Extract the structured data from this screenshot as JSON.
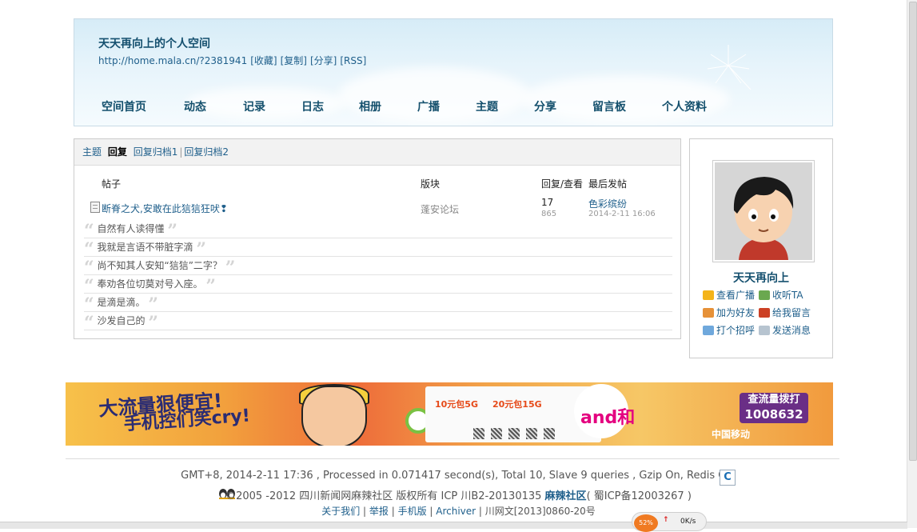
{
  "header": {
    "site_title": "天天再向上的个人空间",
    "url": "http://home.mala.cn/?2381941",
    "links": [
      "[收藏]",
      "[复制]",
      "[分享]",
      "[RSS]"
    ]
  },
  "nav": [
    "空间首页",
    "动态",
    "记录",
    "日志",
    "相册",
    "广播",
    "主题",
    "分享",
    "留言板",
    "个人资料"
  ],
  "tabs": {
    "items": [
      "主题",
      "回复",
      "回复归档1",
      "回复归档2"
    ],
    "active": "回复"
  },
  "table": {
    "headers": [
      "帖子",
      "版块",
      "回复/查看",
      "最后发帖"
    ],
    "row": {
      "subject": "断脊之犬,安敢在此狺狺狂吠❢",
      "forum": "蓬安论坛",
      "replies": "17",
      "views": "865",
      "last_user": "色彩缤纷",
      "last_time": "2014-2-11 16:06"
    },
    "quotes": [
      "自然有人读得懂",
      "我就是言语不带脏字滴",
      "尚不知其人安知“狺狺”二字？",
      "奉劝各位切莫对号入座。",
      "是滴是滴。",
      "沙发自己的"
    ]
  },
  "profile": {
    "name": "天天再向上",
    "actions": [
      "查看广播",
      "收听TA",
      "加为好友",
      "给我留言",
      "打个招呼",
      "发送消息"
    ]
  },
  "banner": {
    "slogan_line1": "大流量狠便宜!",
    "slogan_line2": "手机控们笑cry!",
    "plan1": "10元包5G",
    "plan2": "20元包15G",
    "brand": "and和",
    "cta_line1": "查流量拨打",
    "cta_line2": "1008632",
    "operator": "中国移动"
  },
  "footer": {
    "line1": "GMT+8, 2014-2-11 17:36 , Processed in 0.071417 second(s), Total 10, Slave 9 queries , Gzip On, Redis On.",
    "line2_pre": "©2005 -2012 四川新闻网麻辣社区 版权所有 ICP 川B2-20130135 ",
    "line2_brand": "麻辣社区",
    "line2_post": "( 蜀ICP备12003267 )",
    "links": [
      "关于我们",
      "举报",
      "手机版",
      "Archiver"
    ],
    "license": "川网文[2013]0860-20号"
  },
  "speed_widget": {
    "percent": "52%",
    "rate": "0K/s"
  }
}
